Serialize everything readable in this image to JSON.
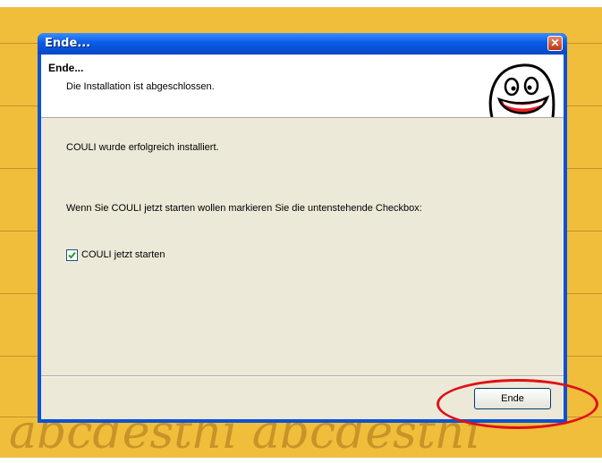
{
  "window": {
    "title": "Ende..."
  },
  "header": {
    "title": "Ende...",
    "subtitle": "Die Installation ist abgeschlossen."
  },
  "body": {
    "message": "COULI wurde erfolgreich installiert.",
    "instruction": "Wenn Sie COULI jetzt starten wollen markieren Sie die untenstehende Checkbox:",
    "checkbox_label": "COULI jetzt starten",
    "checkbox_checked": true
  },
  "footer": {
    "finish_button": "Ende"
  },
  "background": {
    "script_text": "abcdesthi abcdesthi"
  },
  "colors": {
    "titlebar": "#0a5be6",
    "window_face": "#ece9d8",
    "desktop": "#f0be3a",
    "annotation": "#e0101a"
  },
  "icons": [
    "close-icon",
    "smiley-logo-icon",
    "checkmark-icon"
  ]
}
